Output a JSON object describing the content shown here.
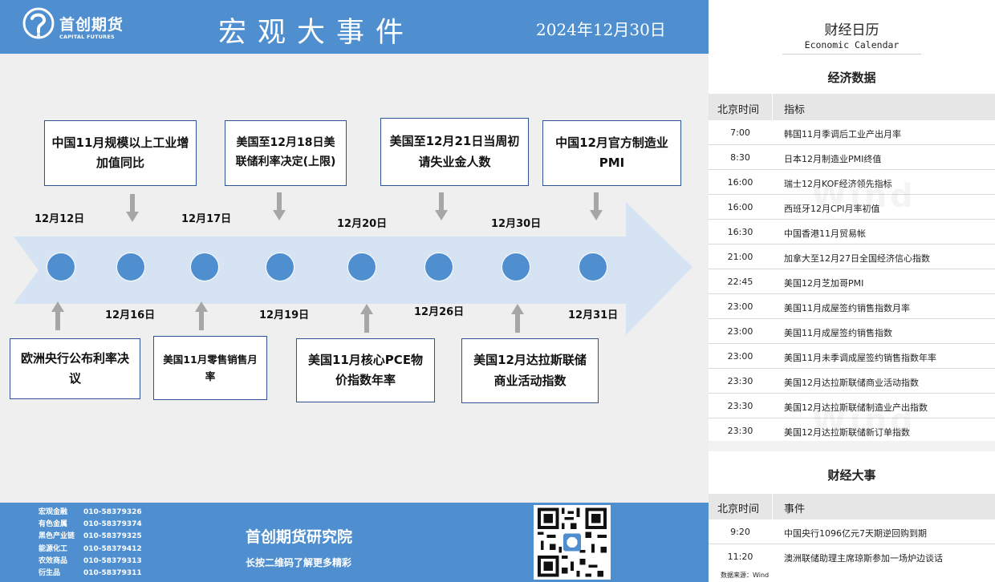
{
  "header": {
    "logo_name": "首创期货",
    "logo_en": "CAPITAL FUTURES",
    "title": "宏观大事件",
    "date": "2024年12月30日"
  },
  "timeline": {
    "dates": [
      {
        "label": "12月12日"
      },
      {
        "label": "12月16日"
      },
      {
        "label": "12月17日"
      },
      {
        "label": "12月19日"
      },
      {
        "label": "12月20日"
      },
      {
        "label": "12月26日"
      },
      {
        "label": "12月30日"
      },
      {
        "label": "12月31日"
      }
    ],
    "events_top": [
      {
        "text": "中国11月规模以上工业增加值同比"
      },
      {
        "text": "美国至12月18日美联储利率决定(上限)"
      },
      {
        "text": "美国至12月21日当周初请失业金人数"
      },
      {
        "text": "中国12月官方制造业PMI"
      }
    ],
    "events_bottom": [
      {
        "text": "欧洲央行公布利率决议"
      },
      {
        "text": "美国11月零售销售月率"
      },
      {
        "text": "美国11月核心PCE物价指数年率"
      },
      {
        "text": "美国12月达拉斯联储商业活动指数"
      }
    ]
  },
  "footer": {
    "contacts": [
      {
        "dept": "宏观金融",
        "phone": "010-58379326"
      },
      {
        "dept": "有色金属",
        "phone": "010-58379374"
      },
      {
        "dept": "黑色产业链",
        "phone": "010-58379325"
      },
      {
        "dept": "能源化工",
        "phone": "010-58379412"
      },
      {
        "dept": "农效商品",
        "phone": "010-58379313"
      },
      {
        "dept": "衍生品",
        "phone": "010-58379311"
      }
    ],
    "institute": "首创期货研究院",
    "slogan": "长按二维码了解更多精彩"
  },
  "calendar": {
    "title": "财经日历",
    "subtitle": "Economic Calendar",
    "data_section": {
      "title": "经济数据",
      "col_time": "北京时间",
      "col_item": "指标",
      "rows": [
        {
          "time": "7:00",
          "item": "韩国11月季调后工业产出月率"
        },
        {
          "time": "8:30",
          "item": "日本12月制造业PMI终值"
        },
        {
          "time": "16:00",
          "item": "瑞士12月KOF经济领先指标"
        },
        {
          "time": "16:00",
          "item": "西班牙12月CPI月率初值"
        },
        {
          "time": "16:30",
          "item": "中国香港11月贸易帐"
        },
        {
          "time": "21:00",
          "item": "加拿大至12月27日全国经济信心指数"
        },
        {
          "time": "22:45",
          "item": "美国12月芝加哥PMI"
        },
        {
          "time": "23:00",
          "item": "美国11月成屋签约销售指数月率"
        },
        {
          "time": "23:00",
          "item": "美国11月成屋签约销售指数"
        },
        {
          "time": "23:00",
          "item": "美国11月未季调成屋签约销售指数年率"
        },
        {
          "time": "23:30",
          "item": "美国12月达拉斯联储商业活动指数"
        },
        {
          "time": "23:30",
          "item": "美国12月达拉斯联储制造业产出指数"
        },
        {
          "time": "23:30",
          "item": "美国12月达拉斯联储新订单指数"
        }
      ]
    },
    "events_section": {
      "title": "财经大事",
      "col_time": "北京时间",
      "col_item": "事件",
      "rows": [
        {
          "time": "9:20",
          "item": "中国央行1096亿元7天期逆回购到期"
        },
        {
          "time": "11:20",
          "item": "澳洲联储助理主席琼斯参加一场炉边谈话"
        }
      ]
    },
    "source": "数据来源：Wind",
    "watermark": "Wind"
  },
  "colors": {
    "brand_blue": "#4f8fd0",
    "arrow_band": "#d5e3f3",
    "box_border": "#2f5496",
    "panel_bg": "#efefef"
  }
}
